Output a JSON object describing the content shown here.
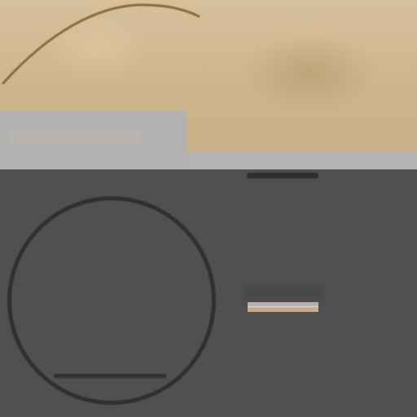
{
  "screen": {
    "colors": {
      "backdrop": "#d6c09c",
      "panel_gray": "#b3b2b1",
      "dark_surface": "#505052",
      "control_stroke": "#303032",
      "accent": "#cfa978"
    }
  },
  "controls": {
    "dial": {
      "icon": "circle-ring-icon"
    },
    "level_indicator": {
      "fill_fraction": 1.0
    }
  }
}
